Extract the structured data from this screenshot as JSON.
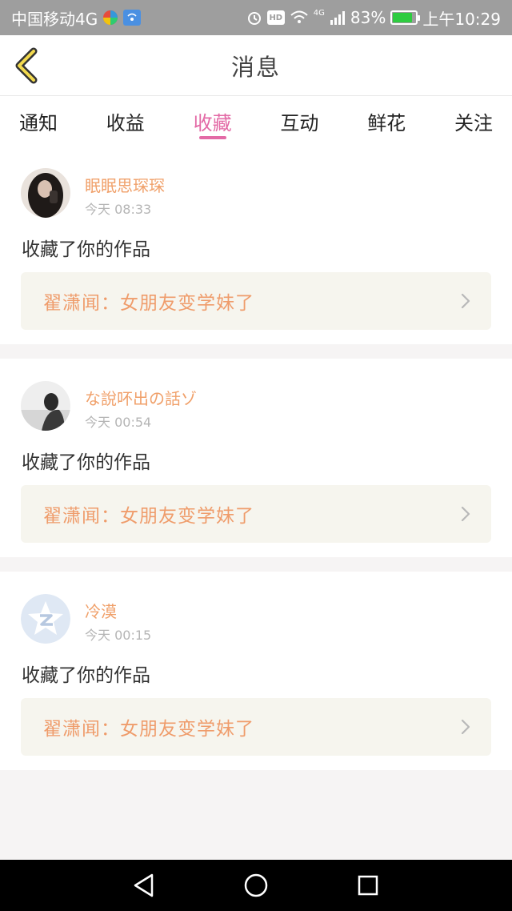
{
  "status_bar": {
    "carrier": "中国移动4G",
    "battery_percent": "83%",
    "battery_level": 0.83,
    "time": "上午10:29",
    "hd_label": "HD",
    "network_label": "4G",
    "icons": [
      "baidu-icon",
      "wifi-hotspot-icon",
      "alarm-icon",
      "hd-icon",
      "wifi-icon",
      "signal-icon",
      "battery-icon"
    ]
  },
  "header": {
    "title": "消息",
    "back_icon": "chevron-left-icon"
  },
  "tabs": [
    {
      "label": "通知",
      "active": false
    },
    {
      "label": "收益",
      "active": false
    },
    {
      "label": "收藏",
      "active": true
    },
    {
      "label": "互动",
      "active": false
    },
    {
      "label": "鲜花",
      "active": false
    },
    {
      "label": "关注",
      "active": false
    }
  ],
  "colors": {
    "accent": "#e36aa6",
    "username": "#f0a06a",
    "work_title": "#ef9c6b",
    "link_bg": "#f6f5ee"
  },
  "notifications": [
    {
      "username": "眠眠思琛琛",
      "time": "今天 08:33",
      "action": "收藏了你的作品",
      "work_title": "翟潇闻：女朋友变学妹了",
      "avatar_icon": "avatar-photo-dark"
    },
    {
      "username": "な說吥出の話ゾ",
      "time": "今天 00:54",
      "action": "收藏了你的作品",
      "work_title": "翟潇闻：女朋友变学妹了",
      "avatar_icon": "avatar-photo-light"
    },
    {
      "username": "冷漠",
      "time": "今天 00:15",
      "action": "收藏了你的作品",
      "work_title": "翟潇闻：女朋友变学妹了",
      "avatar_icon": "qzone-star-icon"
    }
  ],
  "nav_bar": {
    "icons": [
      "back-triangle-icon",
      "home-circle-icon",
      "recents-square-icon"
    ]
  }
}
